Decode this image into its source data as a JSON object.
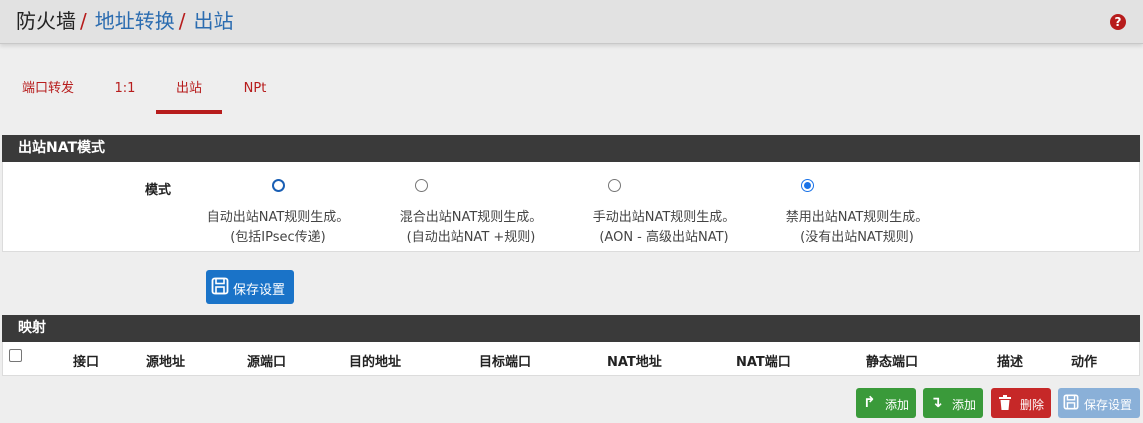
{
  "breadcrumb": {
    "root": "防火墙",
    "sep1": "/",
    "link1": "地址转换",
    "sep2": "/",
    "link2": "出站"
  },
  "help_icon_text": "?",
  "tabs": [
    {
      "label": "端口转发",
      "active": false
    },
    {
      "label": "1:1",
      "active": false
    },
    {
      "label": "出站",
      "active": true
    },
    {
      "label": "NPt",
      "active": false
    }
  ],
  "nat_mode": {
    "title": "出站NAT模式",
    "label": "模式",
    "options": [
      {
        "line1": "自动出站NAT规则生成。",
        "line2": "(包括IPsec传递)",
        "selected": false
      },
      {
        "line1": "混合出站NAT规则生成。",
        "line2": "(自动出站NAT +规则)",
        "selected": false
      },
      {
        "line1": "手动出站NAT规则生成。",
        "line2": "(AON - 高级出站NAT)",
        "selected": false
      },
      {
        "line1": "禁用出站NAT规则生成。",
        "line2": "(没有出站NAT规则)",
        "selected": true
      }
    ],
    "save_button": "保存设置"
  },
  "mappings": {
    "title": "映射",
    "columns": [
      "接口",
      "源地址",
      "源端口",
      "目的地址",
      "目标端口",
      "NAT地址",
      "NAT端口",
      "静态端口",
      "描述",
      "动作"
    ]
  },
  "actions": {
    "add_top": "添加",
    "add_bottom": "添加",
    "delete": "删除",
    "save": "保存设置"
  },
  "colors": {
    "accent_red": "#b71c1c",
    "link_blue": "#2b6cb0",
    "save_blue": "#1a73c8",
    "add_green": "#3a9a3a",
    "delete_red": "#c62828",
    "disabled_blue": "#8ab0d8",
    "panel_header": "#3a3a3a"
  }
}
